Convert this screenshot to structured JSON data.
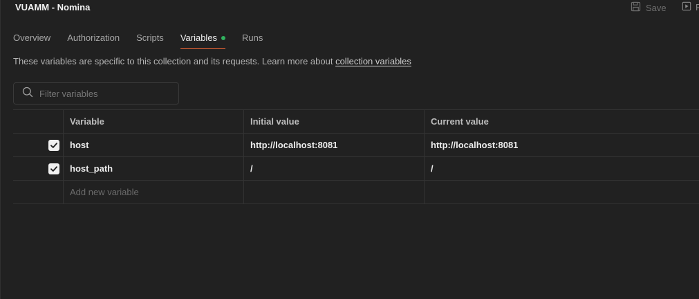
{
  "header": {
    "title": "VUAMM - Nomina",
    "save_label": "Save",
    "run_label": "R"
  },
  "tabs": [
    {
      "label": "Overview",
      "active": false
    },
    {
      "label": "Authorization",
      "active": false
    },
    {
      "label": "Scripts",
      "active": false
    },
    {
      "label": "Variables",
      "active": true
    },
    {
      "label": "Runs",
      "active": false
    }
  ],
  "description": {
    "text": "These variables are specific to this collection and its requests. Learn more about ",
    "link": "collection variables"
  },
  "filter": {
    "placeholder": "Filter variables"
  },
  "table": {
    "columns": [
      "Variable",
      "Initial value",
      "Current value"
    ],
    "rows": [
      {
        "checked": true,
        "variable": "host",
        "initial": "http://localhost:8081",
        "current": "http://localhost:8081"
      },
      {
        "checked": true,
        "variable": "host_path",
        "initial": "/",
        "current": "/"
      }
    ],
    "add_placeholder": "Add new variable"
  },
  "colors": {
    "accent": "#ff6c37",
    "status_dot": "#30b25e",
    "background": "#212121"
  }
}
